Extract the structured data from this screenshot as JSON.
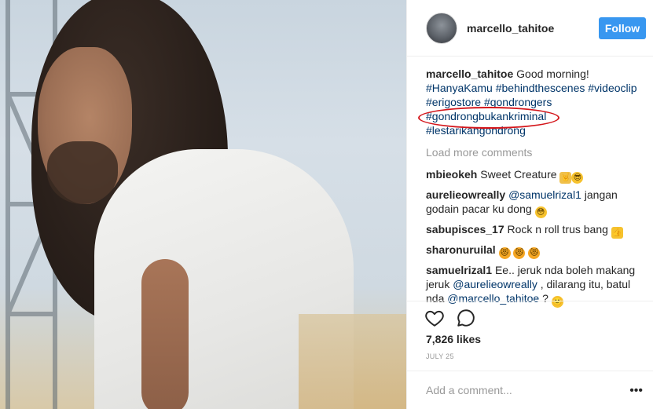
{
  "post": {
    "author": "marcello_tahitoe",
    "follow_label": "Follow",
    "caption_text": " Good morning!",
    "hashtags": [
      "#HanyaKamu",
      "#behindthescenes",
      "#videoclip",
      "#erigostore",
      "#gondrongers",
      "#gondrongbukankriminal",
      "#lestarikangondrong"
    ]
  },
  "load_more": "Load more comments",
  "comments": [
    {
      "user": "mbieokeh",
      "text": "Sweet Creature"
    },
    {
      "user": "aurelieowreally",
      "mention": "@samuelrizal1",
      "text": " jangan godain pacar ku dong"
    },
    {
      "user": "sabupisces_17",
      "text": "Rock n roll trus bang"
    },
    {
      "user": "sharonuruilal",
      "text": ""
    },
    {
      "user": "samuelrizal1",
      "text_a": "Ee.. jeruk nda boleh makang jeruk ",
      "mention_a": "@aurelieowreally",
      "text_b": " , dilarang itu, batul nda ",
      "mention_b": "@marcello_tahitoe",
      "text_c": " ?"
    }
  ],
  "likes": "7,826 likes",
  "date": "July 25",
  "add_comment_placeholder": "Add a comment...",
  "more_label": "•••",
  "icons": {
    "heart": "heart-icon",
    "comment": "comment-bubble-icon",
    "more": "more-icon"
  },
  "colors": {
    "follow": "#3897f0",
    "hashtag": "#003569",
    "annotation": "#d4161b"
  }
}
